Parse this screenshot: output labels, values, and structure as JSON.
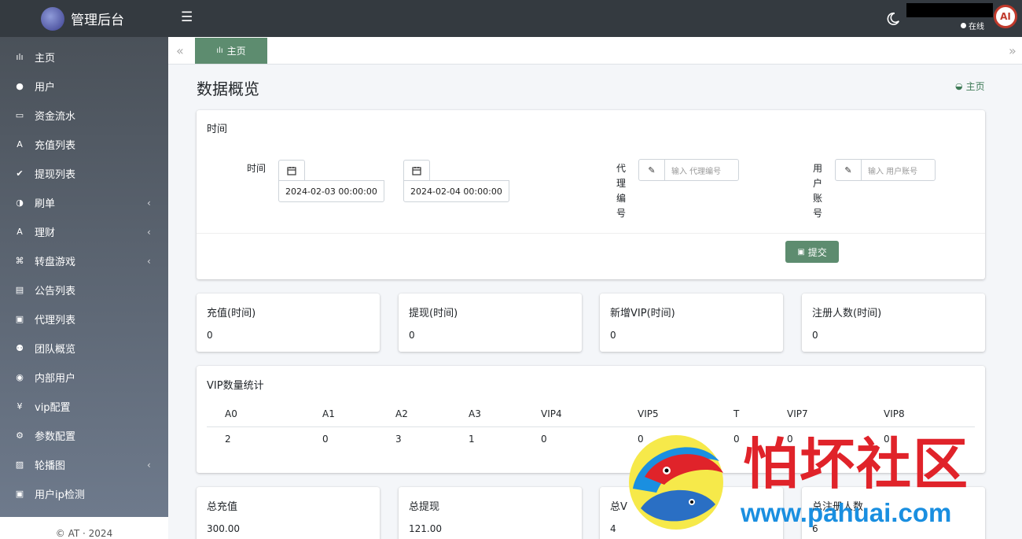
{
  "brand": {
    "title": "管理后台"
  },
  "topbar": {
    "online_label": "在线",
    "avatar_text": "AI"
  },
  "sidebar": {
    "items": [
      {
        "label": "主页",
        "icon": "bar-chart-icon",
        "glyph": "ılı",
        "submenu": false
      },
      {
        "label": "用户",
        "icon": "user-icon",
        "glyph": "●",
        "submenu": false
      },
      {
        "label": "资金流水",
        "icon": "money-icon",
        "glyph": "▭",
        "submenu": false
      },
      {
        "label": "充值列表",
        "icon": "deposit-icon",
        "glyph": "A",
        "submenu": false
      },
      {
        "label": "提现列表",
        "icon": "check-square-icon",
        "glyph": "✔",
        "submenu": false
      },
      {
        "label": "刷单",
        "icon": "half-circle-icon",
        "glyph": "◑",
        "submenu": true
      },
      {
        "label": "理财",
        "icon": "finance-icon",
        "glyph": "A",
        "submenu": true
      },
      {
        "label": "转盘游戏",
        "icon": "gamepad-icon",
        "glyph": "⌘",
        "submenu": true
      },
      {
        "label": "公告列表",
        "icon": "document-icon",
        "glyph": "▤",
        "submenu": false
      },
      {
        "label": "代理列表",
        "icon": "agent-icon",
        "glyph": "▣",
        "submenu": false
      },
      {
        "label": "团队概览",
        "icon": "team-icon",
        "glyph": "⚉",
        "submenu": false
      },
      {
        "label": "内部用户",
        "icon": "user-circle-icon",
        "glyph": "◉",
        "submenu": false
      },
      {
        "label": "vip配置",
        "icon": "yen-icon",
        "glyph": "¥",
        "submenu": false
      },
      {
        "label": "参数配置",
        "icon": "gears-icon",
        "glyph": "⚙",
        "submenu": false
      },
      {
        "label": "轮播图",
        "icon": "image-icon",
        "glyph": "▨",
        "submenu": true
      },
      {
        "label": "用户ip检测",
        "icon": "id-card-icon",
        "glyph": "▣",
        "submenu": false
      }
    ],
    "footer": "© AT · 2024"
  },
  "tabs": {
    "active_label": "主页"
  },
  "page": {
    "title": "数据概览",
    "breadcrumb": "主页"
  },
  "filter": {
    "card_title": "时间",
    "time_label": "时间",
    "start_time": "2024-02-03 00:00:00",
    "end_time": "2024-02-04 00:00:00",
    "agent_label": [
      "代",
      "理",
      "编",
      "号"
    ],
    "agent_placeholder": "输入 代理编号",
    "user_label": [
      "用",
      "户",
      "账",
      "号"
    ],
    "user_placeholder": "输入 用户账号",
    "submit_label": "提交"
  },
  "period_stats": [
    {
      "label": "充值(时间)",
      "value": "0"
    },
    {
      "label": "提现(时间)",
      "value": "0"
    },
    {
      "label": "新增VIP(时间)",
      "value": "0"
    },
    {
      "label": "注册人数(时间)",
      "value": "0"
    }
  ],
  "vip_stats": {
    "title": "VIP数量统计",
    "headers": [
      "A0",
      "A1",
      "A2",
      "A3",
      "VIP4",
      "VIP5",
      "T",
      "VIP7",
      "VIP8"
    ],
    "values": [
      "2",
      "0",
      "3",
      "1",
      "0",
      "0",
      "0",
      "0",
      "0"
    ]
  },
  "total_stats": [
    {
      "label": "总充值",
      "value": "300.00"
    },
    {
      "label": "总提现",
      "value": "121.00"
    },
    {
      "label": "总V",
      "value": "4"
    },
    {
      "label": "总注册人数",
      "value": "6"
    }
  ],
  "watermark": {
    "title": "怕坏社区",
    "url": "www.pahuai.com"
  },
  "colors": {
    "topbar": "#343a40",
    "accent": "#5d8c6f",
    "sidebar_top": "#4a5159",
    "sidebar_bottom": "#6e7a8c",
    "watermark_red": "#e0232a",
    "watermark_blue": "#1a8fe0"
  }
}
